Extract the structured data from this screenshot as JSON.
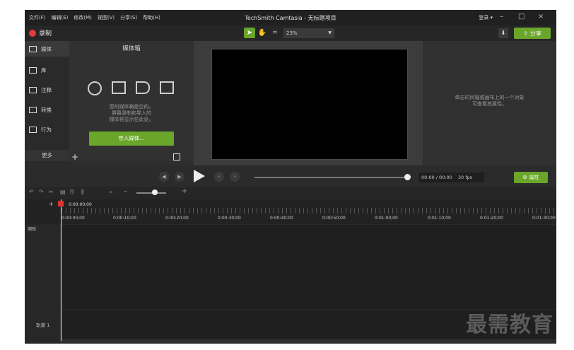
{
  "titlebar": {
    "menu": [
      "文件(F)",
      "编辑(E)",
      "修改(M)",
      "视图(V)",
      "分享(S)",
      "帮助(H)"
    ],
    "title": "TechSmith Camtasia - 无标题项目",
    "login": "登录 ▾",
    "minimize": "–",
    "maximize": "□",
    "close": "×"
  },
  "toolbar": {
    "record_label": "录制",
    "zoom_value": "23%",
    "share_label": "分享"
  },
  "sidebar": {
    "items": [
      {
        "label": "媒体",
        "icon": "media-icon"
      },
      {
        "label": "库",
        "icon": "library-icon"
      },
      {
        "label": "注释",
        "icon": "annotation-icon"
      },
      {
        "label": "转换",
        "icon": "transition-icon"
      },
      {
        "label": "行为",
        "icon": "behavior-icon"
      }
    ],
    "more_label": "更多"
  },
  "media_bin": {
    "title": "媒体箱",
    "empty_lines": [
      "您的媒体箱是空的。",
      "屏幕录制和导入的",
      "媒体将显示在此处。"
    ],
    "import_label": "导入媒体..."
  },
  "properties": {
    "hint_lines": [
      "单击时间轴或画布上的一个对象",
      "可查看其属性。"
    ],
    "button_label": "属性"
  },
  "playback": {
    "time": "00:00 / 00:00",
    "fps": "30 fps"
  },
  "timeline": {
    "playhead_time": "0:00:00;00",
    "ruler_labels": [
      "0:00:00;00",
      "0:00:10;00",
      "0:00:20;00",
      "0:00:30;00",
      "0:00:40;00",
      "0:00:50;00",
      "0:01:00;00",
      "0:01:10;00",
      "0:01:20;00",
      "0:01:30;00"
    ],
    "marker_label": "测验",
    "track_name": "轨道 1"
  },
  "watermark": "最需教育"
}
